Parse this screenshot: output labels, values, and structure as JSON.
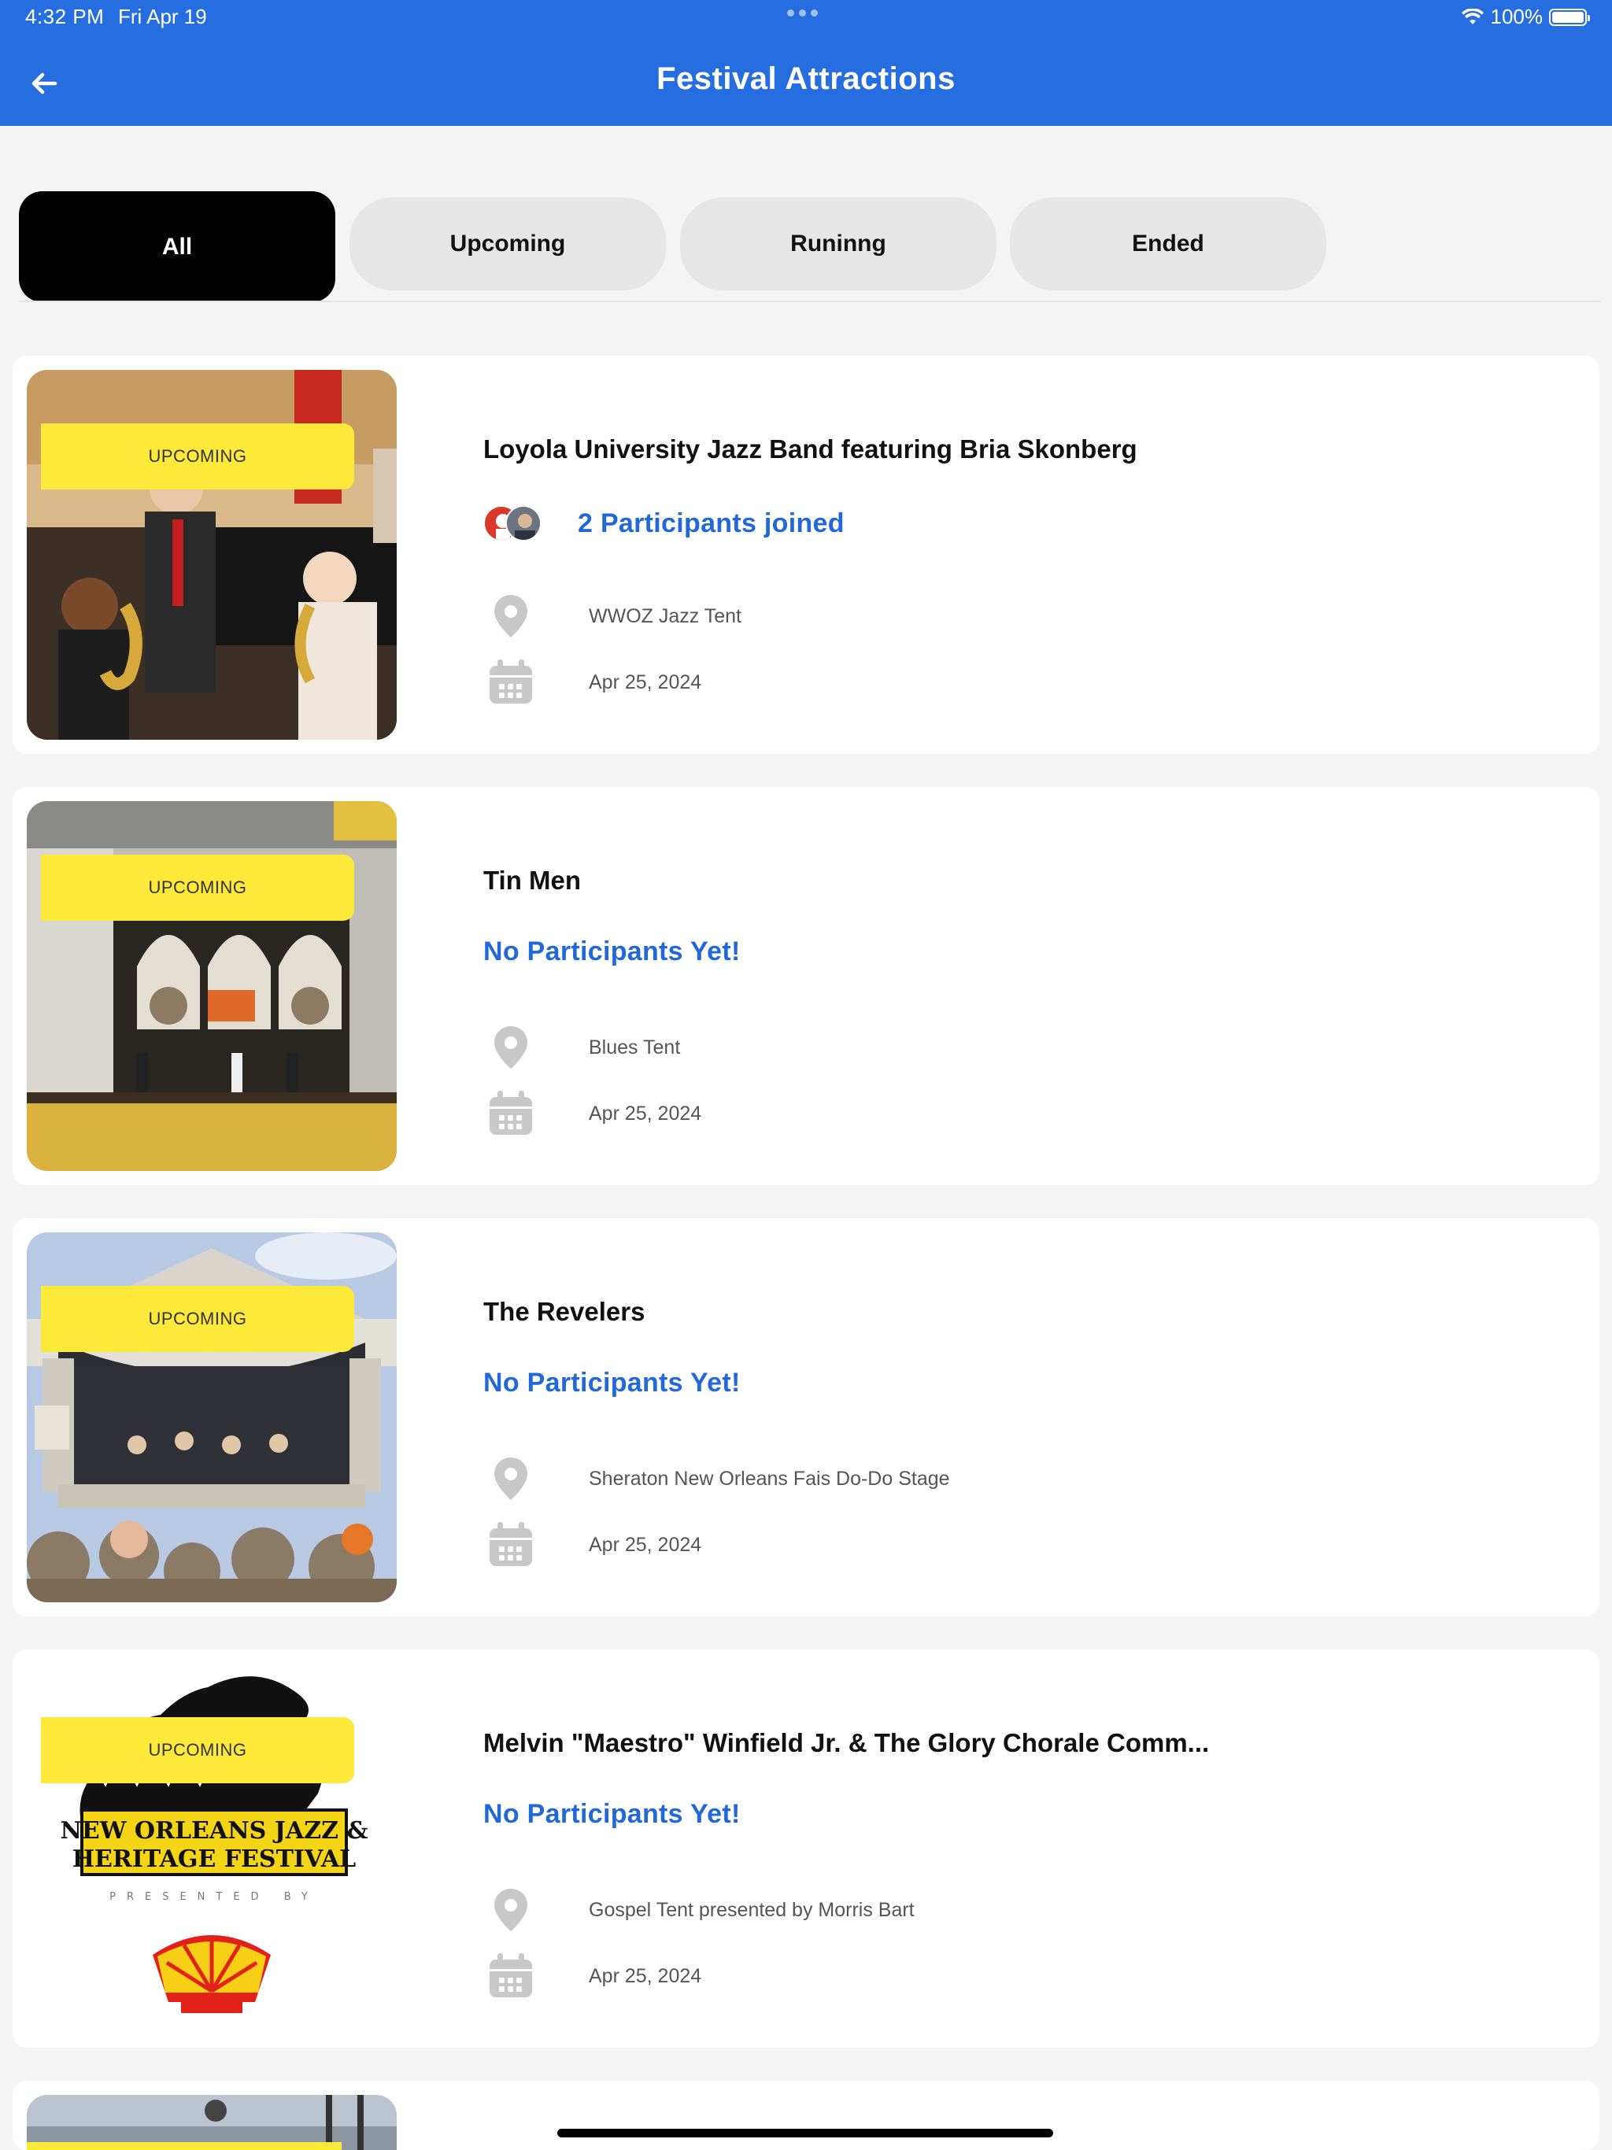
{
  "status_bar": {
    "time": "4:32 PM",
    "date": "Fri Apr 19",
    "battery": "100%",
    "battery_level": 1.0
  },
  "header": {
    "title": "Festival Attractions",
    "back_icon": "arrow-left-icon"
  },
  "tabs": [
    {
      "label": "All",
      "active": true
    },
    {
      "label": "Upcoming",
      "active": false
    },
    {
      "label": "Runinng",
      "active": false
    },
    {
      "label": "Ended",
      "active": false
    }
  ],
  "colors": {
    "header_blue": "#266ee0",
    "badge_yellow": "#fce93a",
    "link_blue": "#2368d8"
  },
  "events": [
    {
      "badge": "UPCOMING",
      "title": "Loyola University Jazz Band featuring Bria Skonberg",
      "participants": "2 Participants joined",
      "location": "WWOZ Jazz Tent",
      "date": "Apr 25, 2024"
    },
    {
      "badge": "UPCOMING",
      "title": "Tin Men",
      "participants": "No Participants Yet!",
      "location": "Blues Tent",
      "date": "Apr 25, 2024"
    },
    {
      "badge": "UPCOMING",
      "title": "The Revelers",
      "participants": "No Participants Yet!",
      "location": "Sheraton New Orleans Fais Do-Do Stage",
      "date": "Apr 25, 2024"
    },
    {
      "badge": "UPCOMING",
      "title": "Melvin \"Maestro\" Winfield Jr. & The Glory Chorale Comm...",
      "participants": "No Participants Yet!",
      "location": "Gospel Tent presented by Morris Bart",
      "date": "Apr 25, 2024",
      "logo_text": [
        "NEW ORLEANS JAZZ &",
        "HERITAGE FESTIVAL",
        "PRESENTED BY"
      ]
    }
  ]
}
